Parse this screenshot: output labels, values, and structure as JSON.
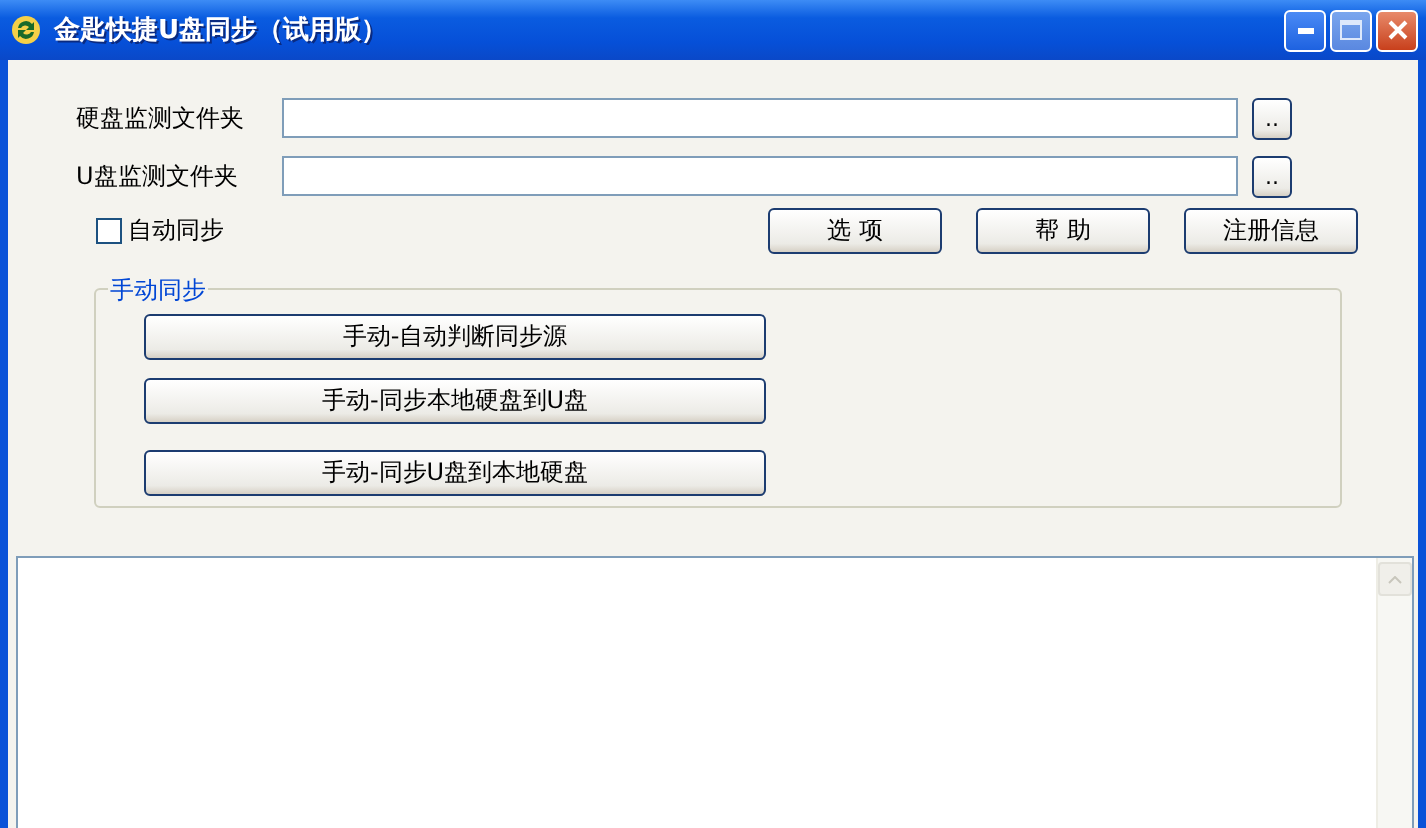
{
  "window": {
    "title": "金匙快捷U盘同步（试用版）"
  },
  "folders": [
    {
      "label": "硬盘监测文件夹",
      "browse": ".."
    },
    {
      "label": "U盘监测文件夹",
      "browse": ".."
    }
  ],
  "auto_sync": {
    "label": "自动同步",
    "checked": false
  },
  "buttons": [
    "选 项",
    "帮 助",
    "注册信息"
  ],
  "manual_sync": {
    "title": "手动同步",
    "buttons": [
      "手动-自动判断同步源",
      "手动-同步本地硬盘到U盘",
      "手动-同步U盘到本地硬盘"
    ]
  }
}
